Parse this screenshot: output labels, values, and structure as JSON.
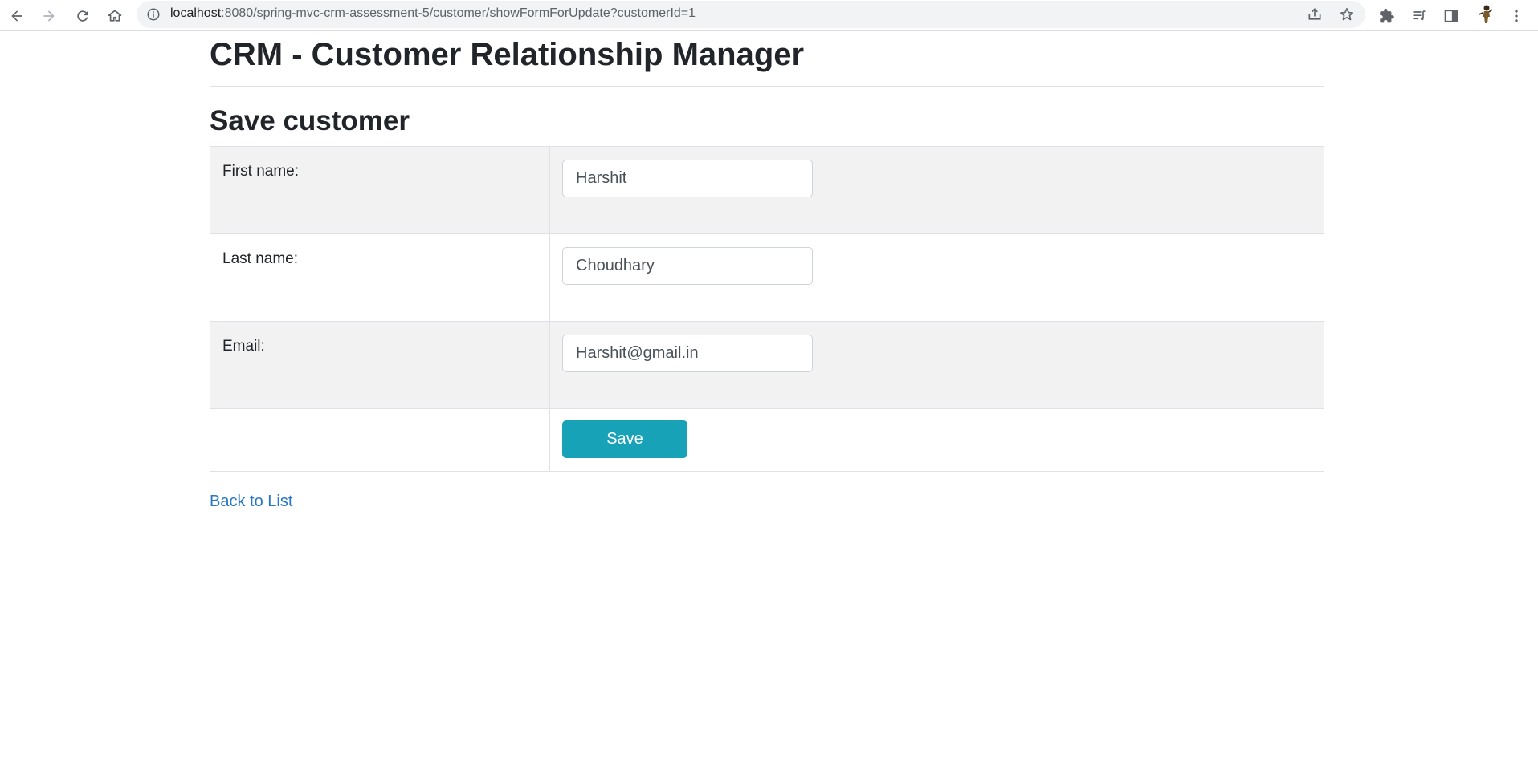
{
  "browser": {
    "url_host": "localhost",
    "url_rest": ":8080/spring-mvc-crm-assessment-5/customer/showFormForUpdate?customerId=1",
    "icons": [
      "back-icon",
      "forward-icon",
      "reload-icon",
      "home-icon",
      "info-icon",
      "share-icon",
      "star-icon",
      "extensions-icon",
      "reading-list-icon",
      "side-panel-icon",
      "avatar",
      "menu-icon"
    ]
  },
  "page": {
    "title": "CRM - Customer Relationship Manager",
    "section_title": "Save customer"
  },
  "form": {
    "rows": [
      {
        "label": "First name:",
        "value": "Harshit"
      },
      {
        "label": "Last name:",
        "value": "Choudhary"
      },
      {
        "label": "Email:",
        "value": "Harshit@gmail.in"
      }
    ],
    "save_label": "Save"
  },
  "links": {
    "back_label": "Back to List"
  },
  "colors": {
    "accent": "#17a2b8",
    "link": "#2a76c6",
    "stripe": "#f2f2f2"
  }
}
